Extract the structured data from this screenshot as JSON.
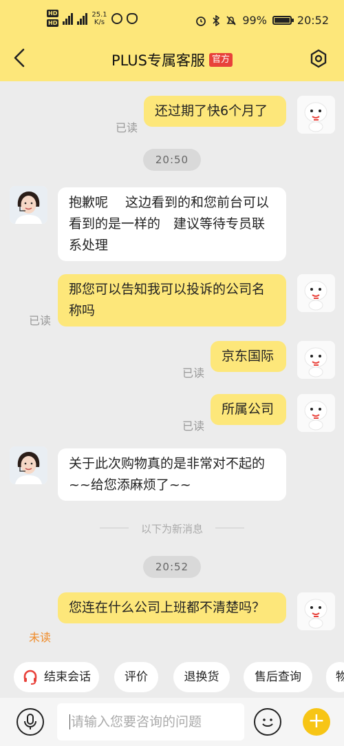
{
  "status_bar": {
    "net_speed": "25.1\nK/s",
    "battery": "99%",
    "time": "20:52"
  },
  "nav": {
    "title": "PLUS专属客服",
    "tag": "官方"
  },
  "messages": [
    {
      "text": "还过期了快6个月了",
      "status": "已读"
    },
    {
      "time": "20:50"
    },
    {
      "text": "抱歉呢　 这边看到的和您前台可以看到的是一样的　建议等待专员联系处理"
    },
    {
      "text": "那您可以告知我可以投诉的公司名称吗",
      "status": "已读"
    },
    {
      "text": "京东国际",
      "status": "已读"
    },
    {
      "text": "所属公司",
      "status": "已读"
    },
    {
      "text": "关于此次购物真的是非常对不起的~~给您添麻烦了~~"
    },
    {
      "divider": "以下为新消息"
    },
    {
      "time": "20:52"
    },
    {
      "text": "您连在什么公司上班都不清楚吗？",
      "status": "未读"
    }
  ],
  "quick_actions": [
    "结束会话",
    "评价",
    "退换货",
    "售后查询",
    "物"
  ],
  "input": {
    "placeholder": "请输入您要咨询的问题"
  },
  "colors": {
    "brand_yellow": "#fde77a",
    "tag_red": "#e8413a",
    "unread_orange": "#f08c2a",
    "plus_yellow": "#f7c515"
  }
}
